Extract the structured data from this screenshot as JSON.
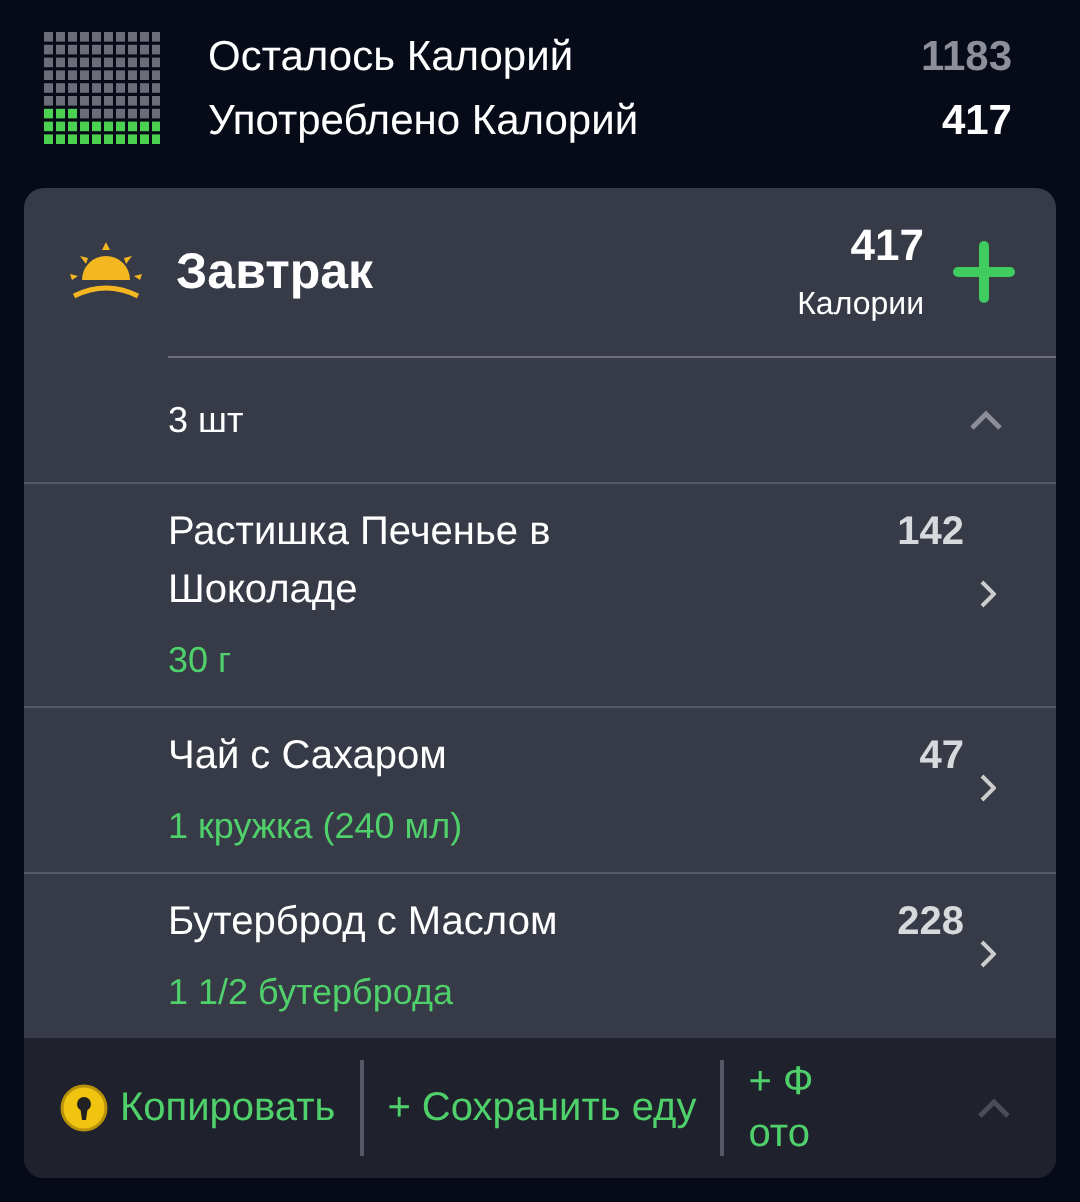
{
  "summary": {
    "rows": [
      {
        "label": "Осталось Калорий",
        "value": "1183",
        "kind": "remaining"
      },
      {
        "label": "Употреблено Калорий",
        "value": "417",
        "kind": "eaten"
      }
    ]
  },
  "meal": {
    "title": "Завтрак",
    "calories": "417",
    "calories_label": "Калории",
    "count": "3 шт",
    "expanded": true,
    "items": [
      {
        "name": "Растишка Печенье в Шоколаде",
        "calories": "142",
        "portion": "30 г"
      },
      {
        "name": "Чай с Сахаром",
        "calories": "47",
        "portion": "1 кружка (240 мл)"
      },
      {
        "name": "Бутерброд с Маслом",
        "calories": "228",
        "portion": "1 1/2 бутерброда"
      }
    ],
    "actions": [
      {
        "label": "Копировать",
        "kind": "copy"
      },
      {
        "label": "+ Сохранить еду",
        "kind": "save"
      },
      {
        "label": "+ Фото",
        "kind": "photo"
      }
    ]
  }
}
